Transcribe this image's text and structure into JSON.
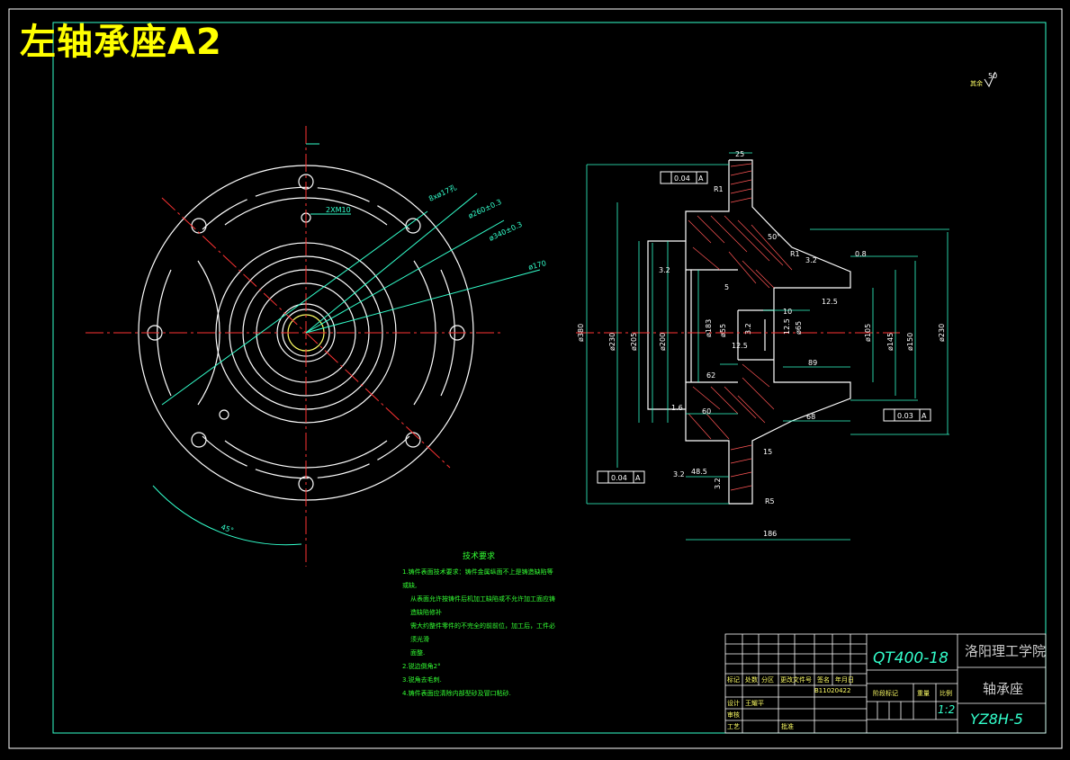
{
  "title": "左轴承座A2",
  "roughness_note": {
    "symbol_label": "其余",
    "value": "50"
  },
  "tech_requirements": {
    "heading": "技术要求",
    "lines": [
      "1.铸件表面技术要求：铸件金属纵面不上是铸造缺陷等或缺,",
      "从表面允许按铸件后机加工缺陷或不允许加工面应铸造缺陷修补",
      "需大约整件零件的不完全的前前位，加工后，工件必须光滑",
      "面整.",
      "2.锐边倒角2°",
      "3.锐角去毛刺.",
      "4.铸件表面应清除内部型砂及冒口粘砂."
    ]
  },
  "title_block": {
    "material": "QT400-18",
    "school": "洛阳理工学院",
    "part_name": "轴承座",
    "drawing_no": "YZ8H-5",
    "scale": "1:2",
    "labels": [
      "标记",
      "处数",
      "分区",
      "更改文件号",
      "签名",
      "年月日",
      "设计",
      "审核",
      "工艺",
      "批准",
      "阶段标记",
      "重量",
      "比例"
    ],
    "student": "B11020422",
    "designer": "王耀平"
  },
  "front_view": {
    "dims": [
      "2XM10",
      "8xø17孔",
      "ø260±0.3",
      "ø340±0.3",
      "ø170",
      "45°"
    ]
  },
  "section_view": {
    "dims": [
      "25",
      "0.04",
      "A",
      "R1",
      "50°",
      "R1",
      "3.2",
      "0.8",
      "3.2",
      "5",
      "ø380",
      "ø230",
      "ø205",
      "ø200",
      "ø183",
      "ø55",
      "3.2",
      "12.5",
      "10",
      "12.5",
      "ø65",
      "ø105",
      "ø145",
      "ø150",
      "ø230",
      "89",
      "62",
      "60",
      "1.6",
      "68",
      "15",
      "48.5",
      "3.2",
      "R5",
      "186",
      "0.03",
      "A",
      "0.04",
      "A",
      "3.2",
      "12.5"
    ]
  }
}
